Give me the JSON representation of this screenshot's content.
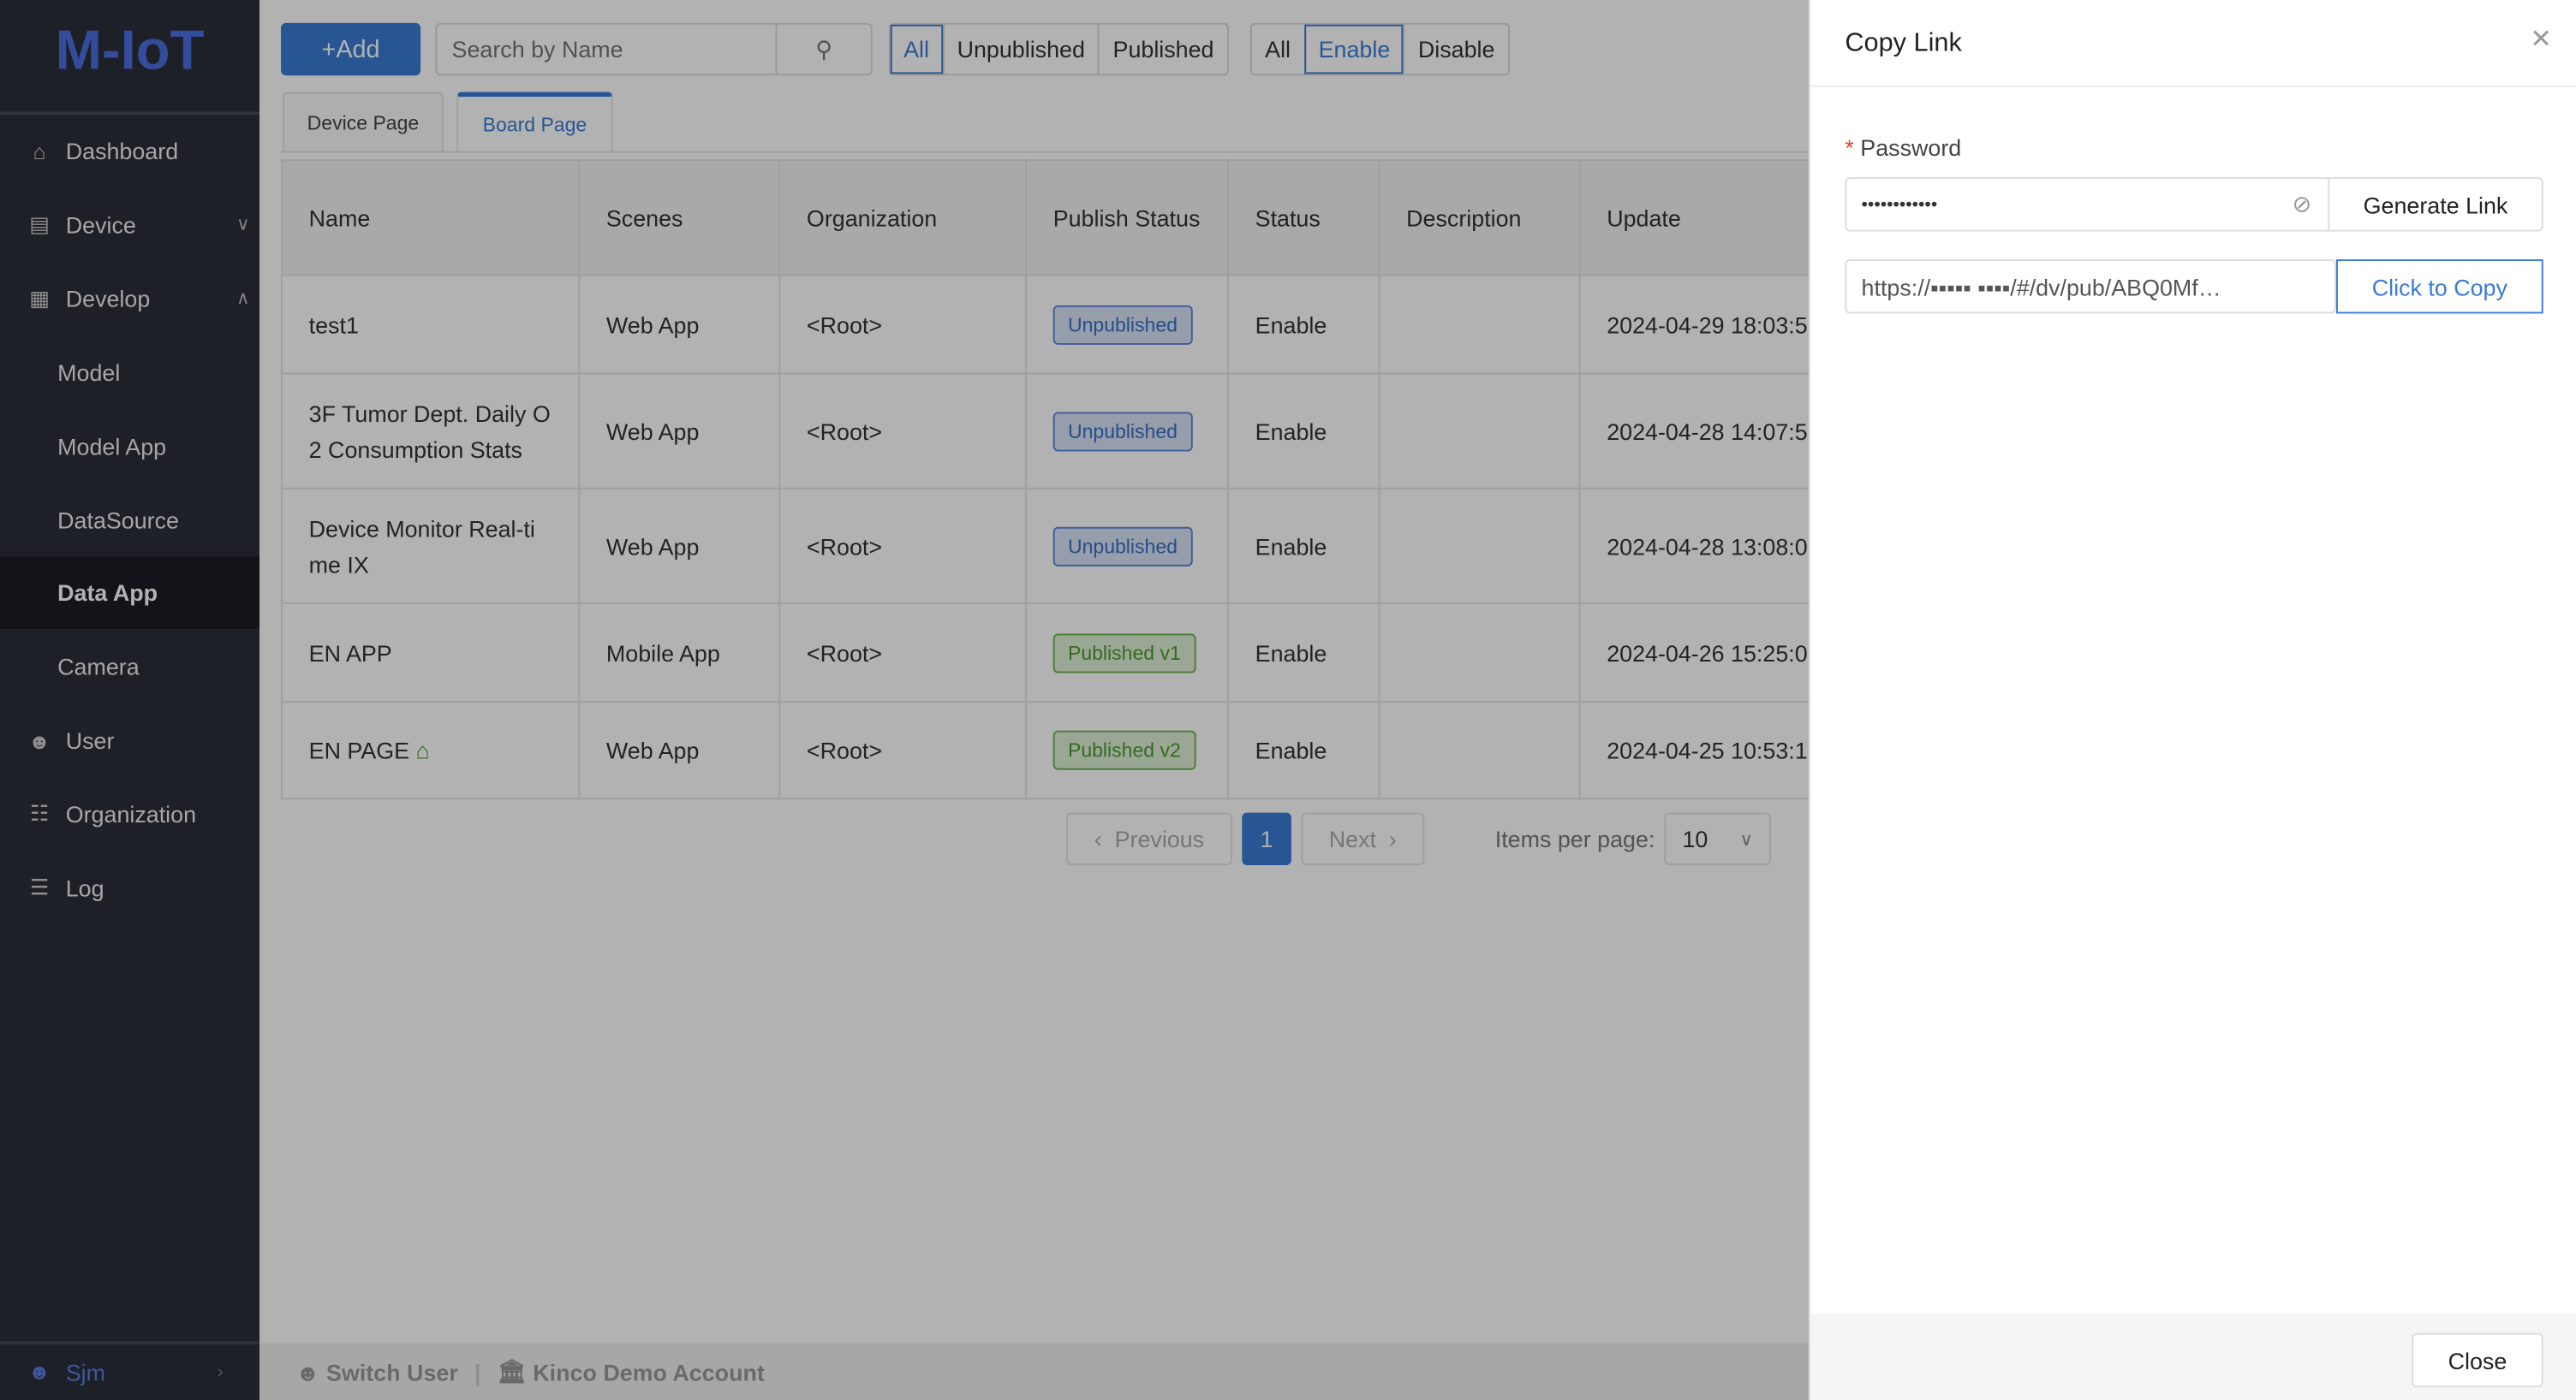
{
  "app": {
    "logo": "M-IoT"
  },
  "sidebar": {
    "items": [
      {
        "label": "Dashboard",
        "icon": "home-icon"
      },
      {
        "label": "Device",
        "icon": "device-icon",
        "chevron": "down"
      },
      {
        "label": "Develop",
        "icon": "grid-icon",
        "chevron": "up"
      },
      {
        "label": "Model",
        "sub": true
      },
      {
        "label": "Model App",
        "sub": true
      },
      {
        "label": "DataSource",
        "sub": true
      },
      {
        "label": "Data App",
        "sub": true,
        "active": true
      },
      {
        "label": "Camera",
        "sub": true
      },
      {
        "label": "User",
        "icon": "user-icon"
      },
      {
        "label": "Organization",
        "icon": "org-icon"
      },
      {
        "label": "Log",
        "icon": "list-icon"
      }
    ],
    "user": "Sjm"
  },
  "toolbar": {
    "add_label": "+Add",
    "search_placeholder": "Search by Name",
    "publish_filter": [
      "All",
      "Unpublished",
      "Published"
    ],
    "publish_selected": "All",
    "status_filter": [
      "All",
      "Enable",
      "Disable"
    ],
    "status_selected": "Enable"
  },
  "tabs": [
    "Device Page",
    "Board Page"
  ],
  "active_tab": "Board Page",
  "table": {
    "columns": [
      "Name",
      "Scenes",
      "Organization",
      "Publish Status",
      "Status",
      "Description",
      "Update"
    ],
    "rows": [
      {
        "name": "test1",
        "scenes": "Web App",
        "org": "<Root>",
        "publish": "Unpublished",
        "status": "Enable",
        "description": "",
        "update": "2024-04-29 18:03:5"
      },
      {
        "name": "3F Tumor Dept. Daily O2 Consumption Stats",
        "scenes": "Web App",
        "org": "<Root>",
        "publish": "Unpublished",
        "status": "Enable",
        "description": "",
        "update": "2024-04-28 14:07:5"
      },
      {
        "name": "Device Monitor Real-time IX",
        "scenes": "Web App",
        "org": "<Root>",
        "publish": "Unpublished",
        "status": "Enable",
        "description": "",
        "update": "2024-04-28 13:08:0"
      },
      {
        "name": "EN APP",
        "scenes": "Mobile App",
        "org": "<Root>",
        "publish": "Published v1",
        "status": "Enable",
        "description": "",
        "update": "2024-04-26 15:25:0"
      },
      {
        "name": "EN PAGE",
        "home": true,
        "scenes": "Web App",
        "org": "<Root>",
        "publish": "Published v2",
        "status": "Enable",
        "description": "",
        "update": "2024-04-25 10:53:1"
      }
    ]
  },
  "pagination": {
    "previous": "Previous",
    "page": "1",
    "next": "Next",
    "per_page_label": "Items per page:",
    "per_page": "10"
  },
  "footer": {
    "switch_user": "Switch User",
    "account": "Kinco Demo Account"
  },
  "drawer": {
    "title": "Copy Link",
    "password_label": "Password",
    "password_value": "••••••••••••",
    "generate_label": "Generate Link",
    "link_value": "https://▪▪▪▪▪ ▪▪▪▪/#/dv/pub/ABQ0Mf…",
    "copy_label": "Click to Copy",
    "close_label": "Close"
  },
  "colors": {
    "accent": "#3a7bd5",
    "sidebar": "#2c2f39",
    "unpublished": "#3a6fc4",
    "published": "#4a9a2e"
  }
}
